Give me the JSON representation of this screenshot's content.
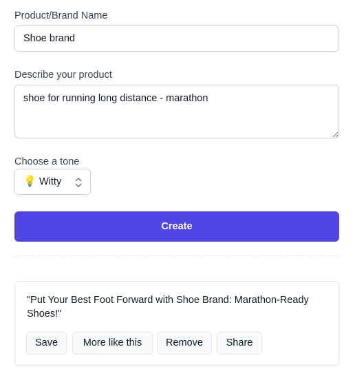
{
  "form": {
    "brand_label": "Product/Brand Name",
    "brand_value": "Shoe brand",
    "description_label": "Describe your product",
    "description_value": "shoe for running long distance - marathon",
    "tone_label": "Choose a tone",
    "tone_emoji": "💡",
    "tone_value": "Witty",
    "create_label": "Create"
  },
  "result": {
    "text": "\"Put Your Best Foot Forward with Shoe Brand: Marathon-Ready Shoes!\"",
    "actions": {
      "save": "Save",
      "more": "More like this",
      "remove": "Remove",
      "share": "Share"
    }
  },
  "colors": {
    "accent": "#4f46e5",
    "border": "#d1d5db",
    "label": "#374151"
  },
  "icons": {
    "tone_icon": "lightbulb-icon",
    "select_icon": "chevron-up-down-icon"
  }
}
